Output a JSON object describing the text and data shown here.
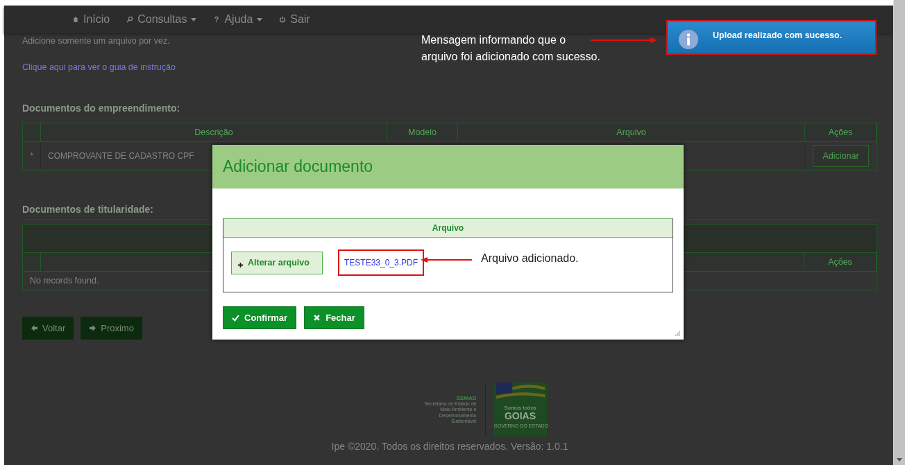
{
  "nav": {
    "items": [
      {
        "label": "Início",
        "dropdown": false
      },
      {
        "label": "Consultas",
        "dropdown": true
      },
      {
        "label": "Ajuda",
        "dropdown": true
      },
      {
        "label": "Sair",
        "dropdown": false
      }
    ]
  },
  "intro_text": "Adicione somente um arquivo por vez.",
  "guide_link": "Clique aqui para ver o guia de instrução",
  "enterprise_docs": {
    "title": "Documentos do empreendimento:",
    "columns": [
      "Descrição",
      "Modelo",
      "Arquivo",
      "Ações"
    ],
    "rows": [
      {
        "marker": "*",
        "description": "COMPROVANTE DE CADASTRO CPF",
        "action": "Adicionar"
      }
    ]
  },
  "holder_docs": {
    "title": "Documentos de titularidade:",
    "last_column": "Ações",
    "empty_message": "No records found."
  },
  "wizard_buttons": [
    {
      "kind": "back",
      "label": "Voltar"
    },
    {
      "kind": "next",
      "label": "Proximo"
    }
  ],
  "footer": {
    "agency": "SEMAD",
    "agency_name": "Secretaria de Estado de Meio Ambiente e Desenvolvimento Sustentável",
    "slogan_top": "Somos todos",
    "slogan": "GOIAS",
    "government": "GOVERNO DO ESTADO",
    "copyright": "Ipe ©2020. Todos os direitos reservados. Versão: 1.0.1"
  },
  "modal": {
    "title": "Adicionar documento",
    "panel_header": "Arquivo",
    "change_button": "Alterar arquivo",
    "file_name": "TESTE33_0_3.PDF",
    "buttons": [
      {
        "kind": "confirm",
        "label": "Confirmar"
      },
      {
        "kind": "close",
        "label": "Fechar"
      }
    ]
  },
  "toast": {
    "kind": "info",
    "message": "Upload realizado com sucesso."
  },
  "annotations": [
    {
      "lines": [
        "Mensagem informando que o",
        "arquivo foi adicionado com sucesso."
      ]
    },
    {
      "lines": [
        "Arquivo adicionado."
      ]
    }
  ]
}
